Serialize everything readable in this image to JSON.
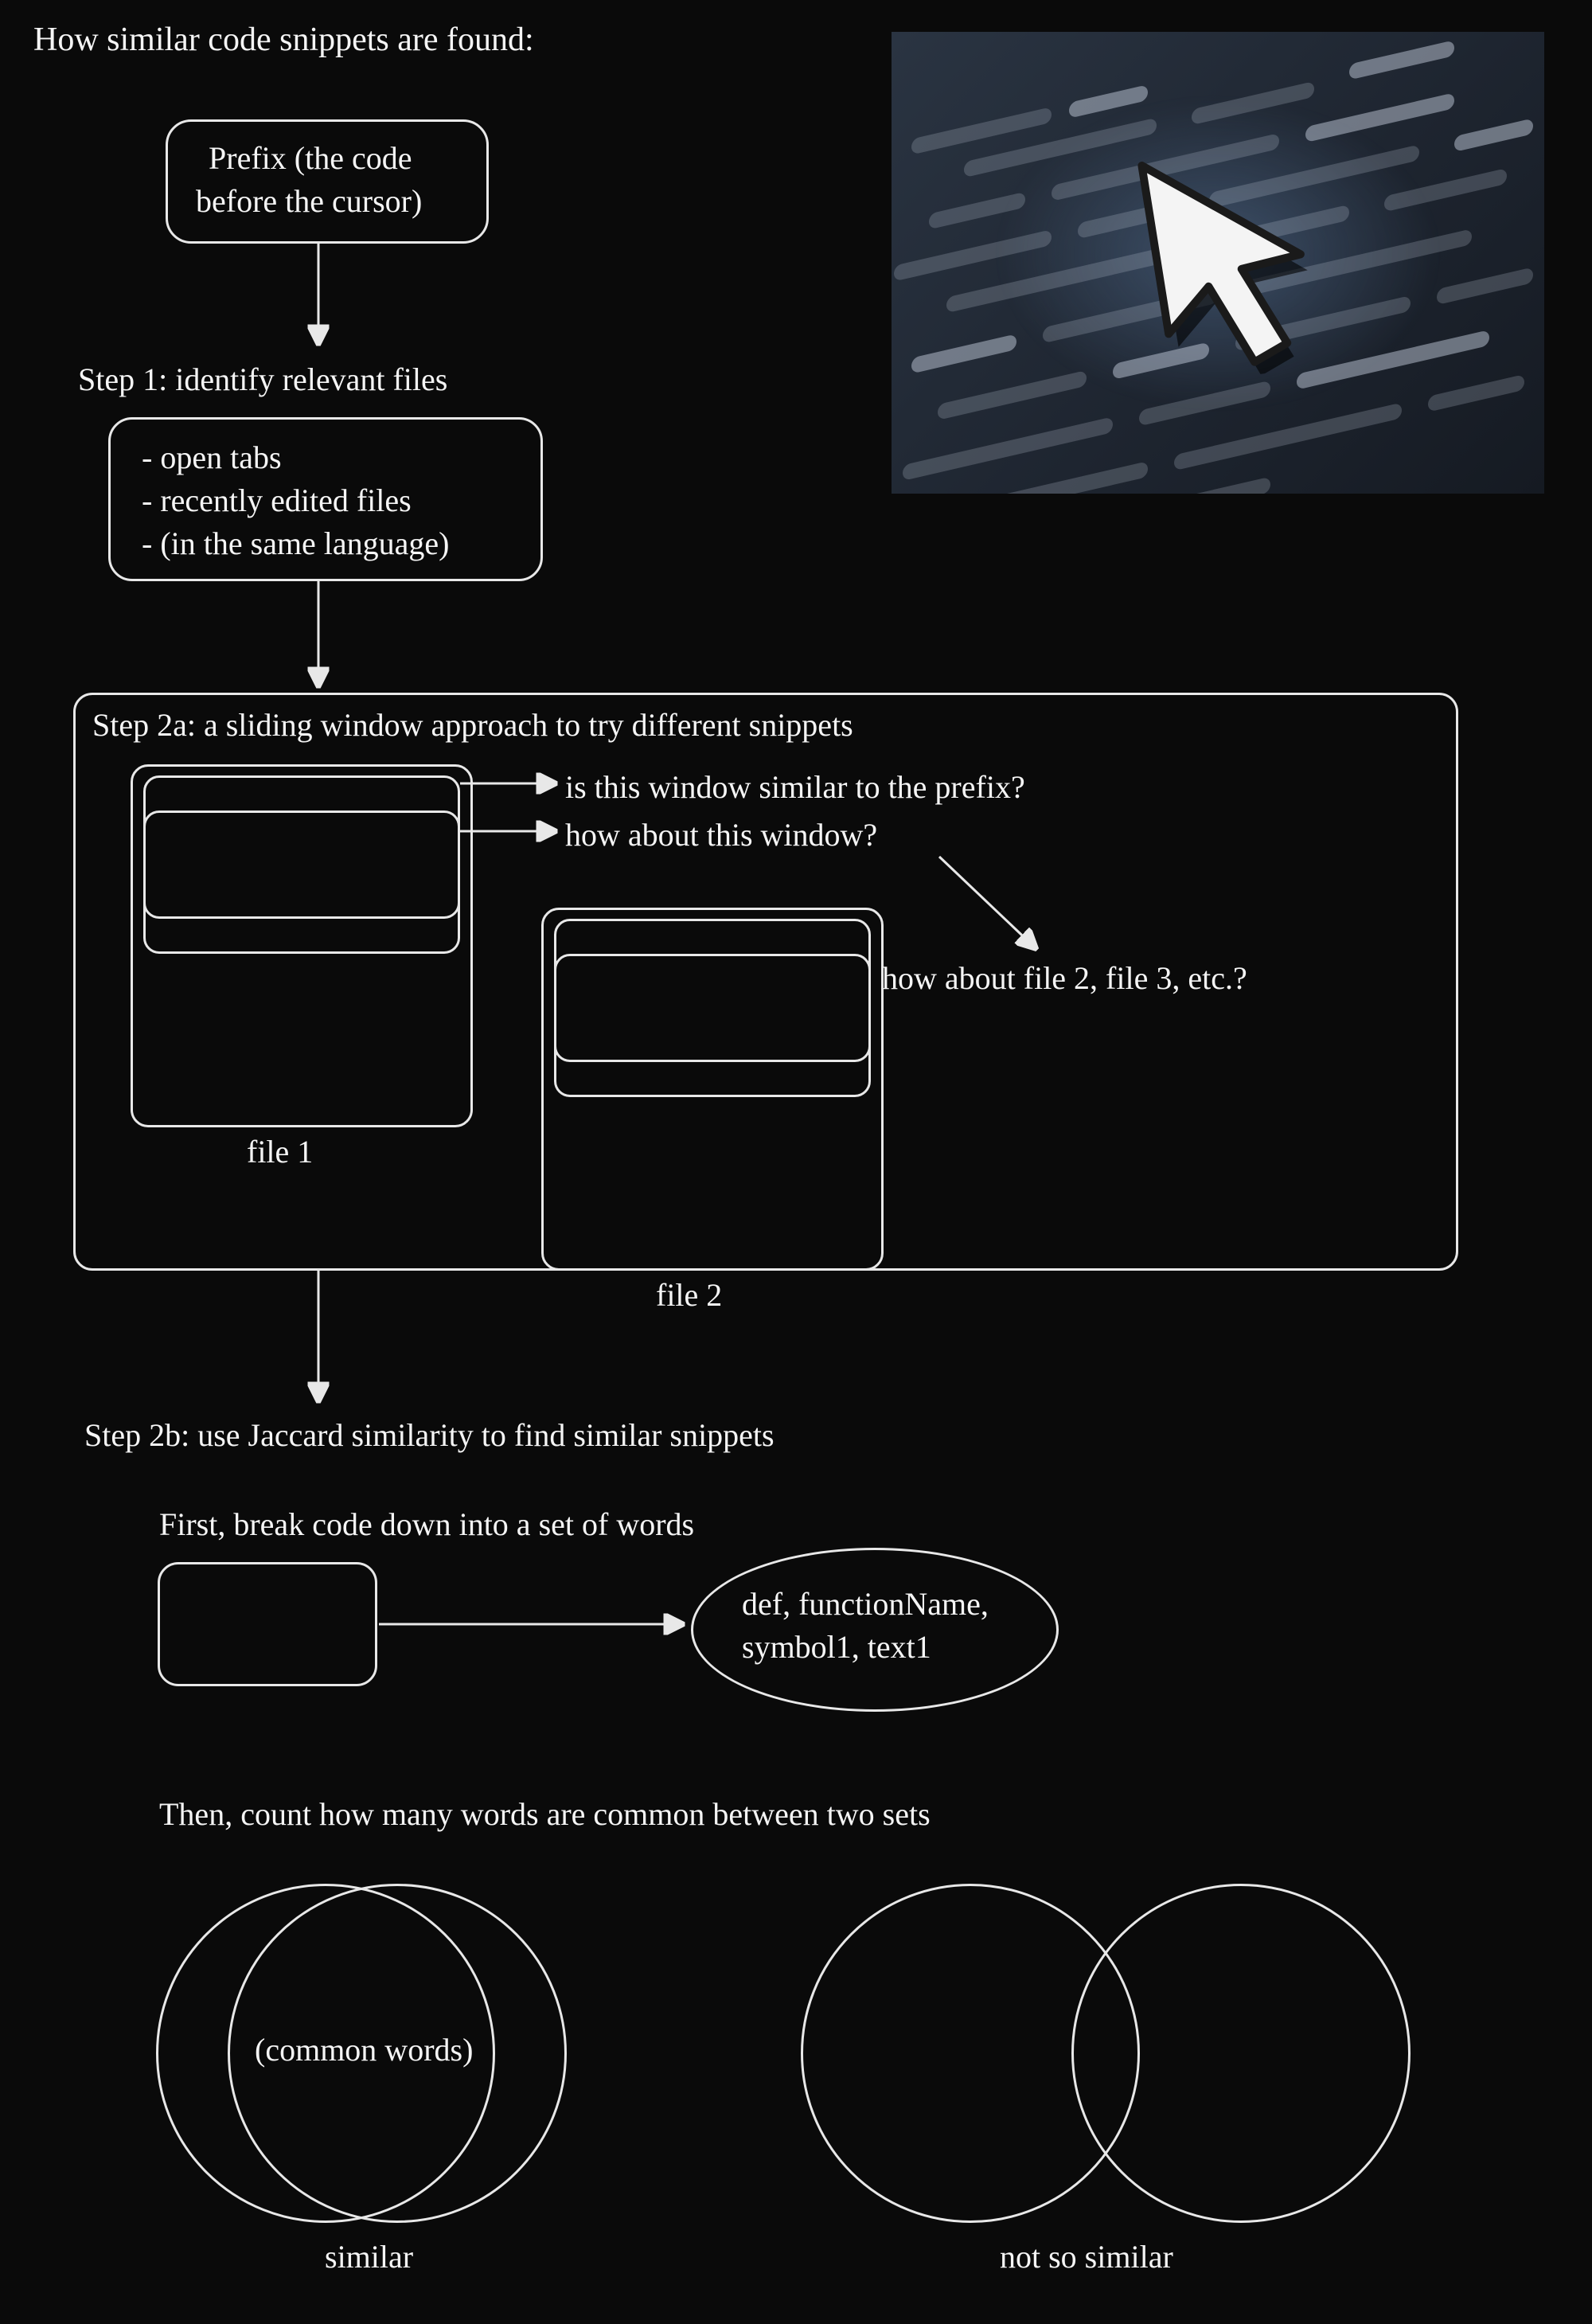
{
  "title": "How similar code snippets are found:",
  "prefix_box_line1": "Prefix (the code",
  "prefix_box_line2": "before the cursor)",
  "step1": {
    "title": "Step 1: identify relevant files",
    "items": [
      "- open tabs",
      "- recently edited files",
      "- (in the same language)"
    ]
  },
  "step2a": {
    "title": "Step 2a: a sliding window approach to try different snippets",
    "q1": "is this window similar to the prefix?",
    "q2": "how about this window?",
    "q3": "how about file 2, file 3, etc.?",
    "file1_label": "file 1",
    "file2_label": "file 2"
  },
  "step2b": {
    "title": "Step 2b: use Jaccard similarity to find similar snippets",
    "first_line": "First, break code down into a set of words",
    "word_set_line1": "def, functionName,",
    "word_set_line2": "symbol1, text1",
    "then_line": "Then, count how many words are common between two sets",
    "common_words_label": "(common words)",
    "similar_label": "similar",
    "not_so_similar_label": "not so similar"
  }
}
